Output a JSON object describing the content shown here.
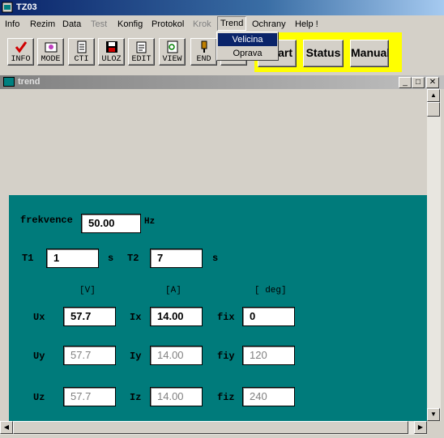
{
  "window": {
    "title": "TZ03"
  },
  "menu": [
    "Info",
    "Rezim",
    "Data",
    "Test",
    "Konfig",
    "Protokol",
    "Krok",
    "Trend",
    "Ochrany",
    "Help !"
  ],
  "trend_menu": [
    "Velicina",
    "Oprava"
  ],
  "toolbar": [
    "INFO",
    "MODE",
    "CTI",
    "ULOZ",
    "EDIT",
    "VIEW",
    "END"
  ],
  "mode_buttons": [
    "Start",
    "Status",
    "Manual"
  ],
  "child_window": {
    "title": "trend"
  },
  "form": {
    "frekvence": {
      "label": "frekvence",
      "value": "50.00",
      "unit": "Hz"
    },
    "t1": {
      "label": "T1",
      "value": "1",
      "unit": "s"
    },
    "t2": {
      "label": "T2",
      "value": "7",
      "unit": "s"
    },
    "units": [
      "[V]",
      "[A]",
      "[ deg]"
    ],
    "rows": [
      {
        "u_label": "Ux",
        "u": "57.7",
        "i_label": "Ix",
        "i": "14.00",
        "f_label": "fix",
        "f": "0"
      },
      {
        "u_label": "Uy",
        "u": "57.7",
        "i_label": "Iy",
        "i": "14.00",
        "f_label": "fiy",
        "f": "120"
      },
      {
        "u_label": "Uz",
        "u": "57.7",
        "i_label": "Iz",
        "i": "14.00",
        "f_label": "fiz",
        "f": "240"
      }
    ]
  },
  "colors": {
    "title_bar": "#0a246a",
    "panel_bg": "#007b7b",
    "mode_bg": "#ffff00",
    "highlight": "#0a246a"
  }
}
